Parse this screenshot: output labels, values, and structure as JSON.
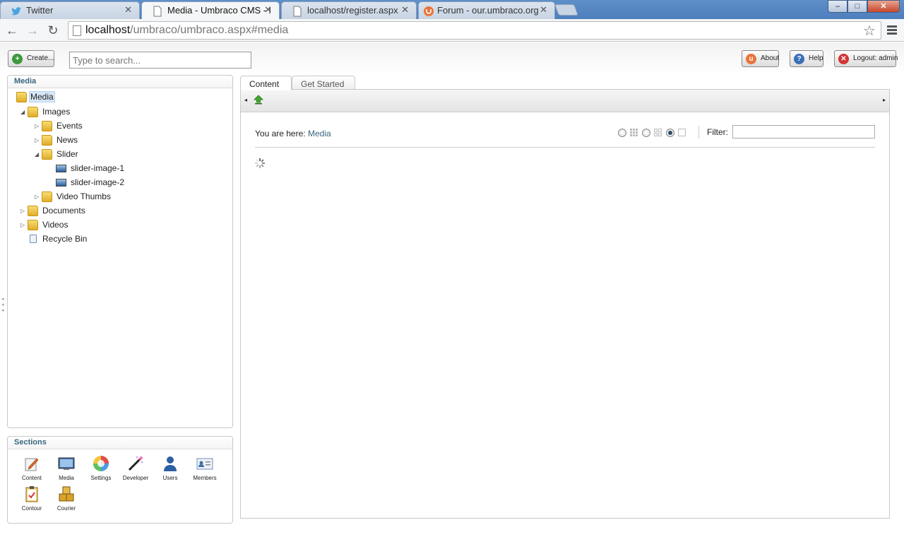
{
  "browser": {
    "tabs": [
      {
        "title": "Twitter",
        "active": false
      },
      {
        "title": "Media - Umbraco CMS - l",
        "active": true
      },
      {
        "title": "localhost/register.aspx",
        "active": false
      },
      {
        "title": "Forum - our.umbraco.org",
        "active": false
      }
    ],
    "url_host": "localhost",
    "url_path": "/umbraco/umbraco.aspx#media",
    "window_buttons": {
      "minimize": "–",
      "maximize": "□",
      "close": "✕"
    },
    "nav": {
      "back": "←",
      "forward": "→",
      "reload": "↻",
      "star": "☆"
    }
  },
  "header": {
    "create_label": "Create...",
    "search_placeholder": "Type to search...",
    "about_label": "About",
    "help_label": "Help",
    "logout_label": "Logout: admin"
  },
  "tree": {
    "title": "Media",
    "nodes": [
      {
        "label": "Media",
        "arrow": ""
      },
      {
        "label": "Images",
        "arrow": "◢"
      },
      {
        "label": "Events",
        "arrow": "▷"
      },
      {
        "label": "News",
        "arrow": "▷"
      },
      {
        "label": "Slider",
        "arrow": "◢"
      },
      {
        "label": "slider-image-1",
        "arrow": ""
      },
      {
        "label": "slider-image-2",
        "arrow": ""
      },
      {
        "label": "Video Thumbs",
        "arrow": "▷"
      },
      {
        "label": "Documents",
        "arrow": "▷"
      },
      {
        "label": "Videos",
        "arrow": "▷"
      },
      {
        "label": "Recycle Bin",
        "arrow": ""
      }
    ]
  },
  "sections": {
    "title": "Sections",
    "items": [
      "Content",
      "Media",
      "Settings",
      "Developer",
      "Users",
      "Members",
      "Contour",
      "Courier"
    ]
  },
  "content": {
    "tabs": [
      "Content",
      "Get Started"
    ],
    "breadcrumb_prefix": "You are here:",
    "breadcrumb_current": "Media",
    "filter_label": "Filter:",
    "filter_value": ""
  },
  "colors": {
    "accent": "#37657f",
    "tab_blue": "#4e7fbd"
  }
}
